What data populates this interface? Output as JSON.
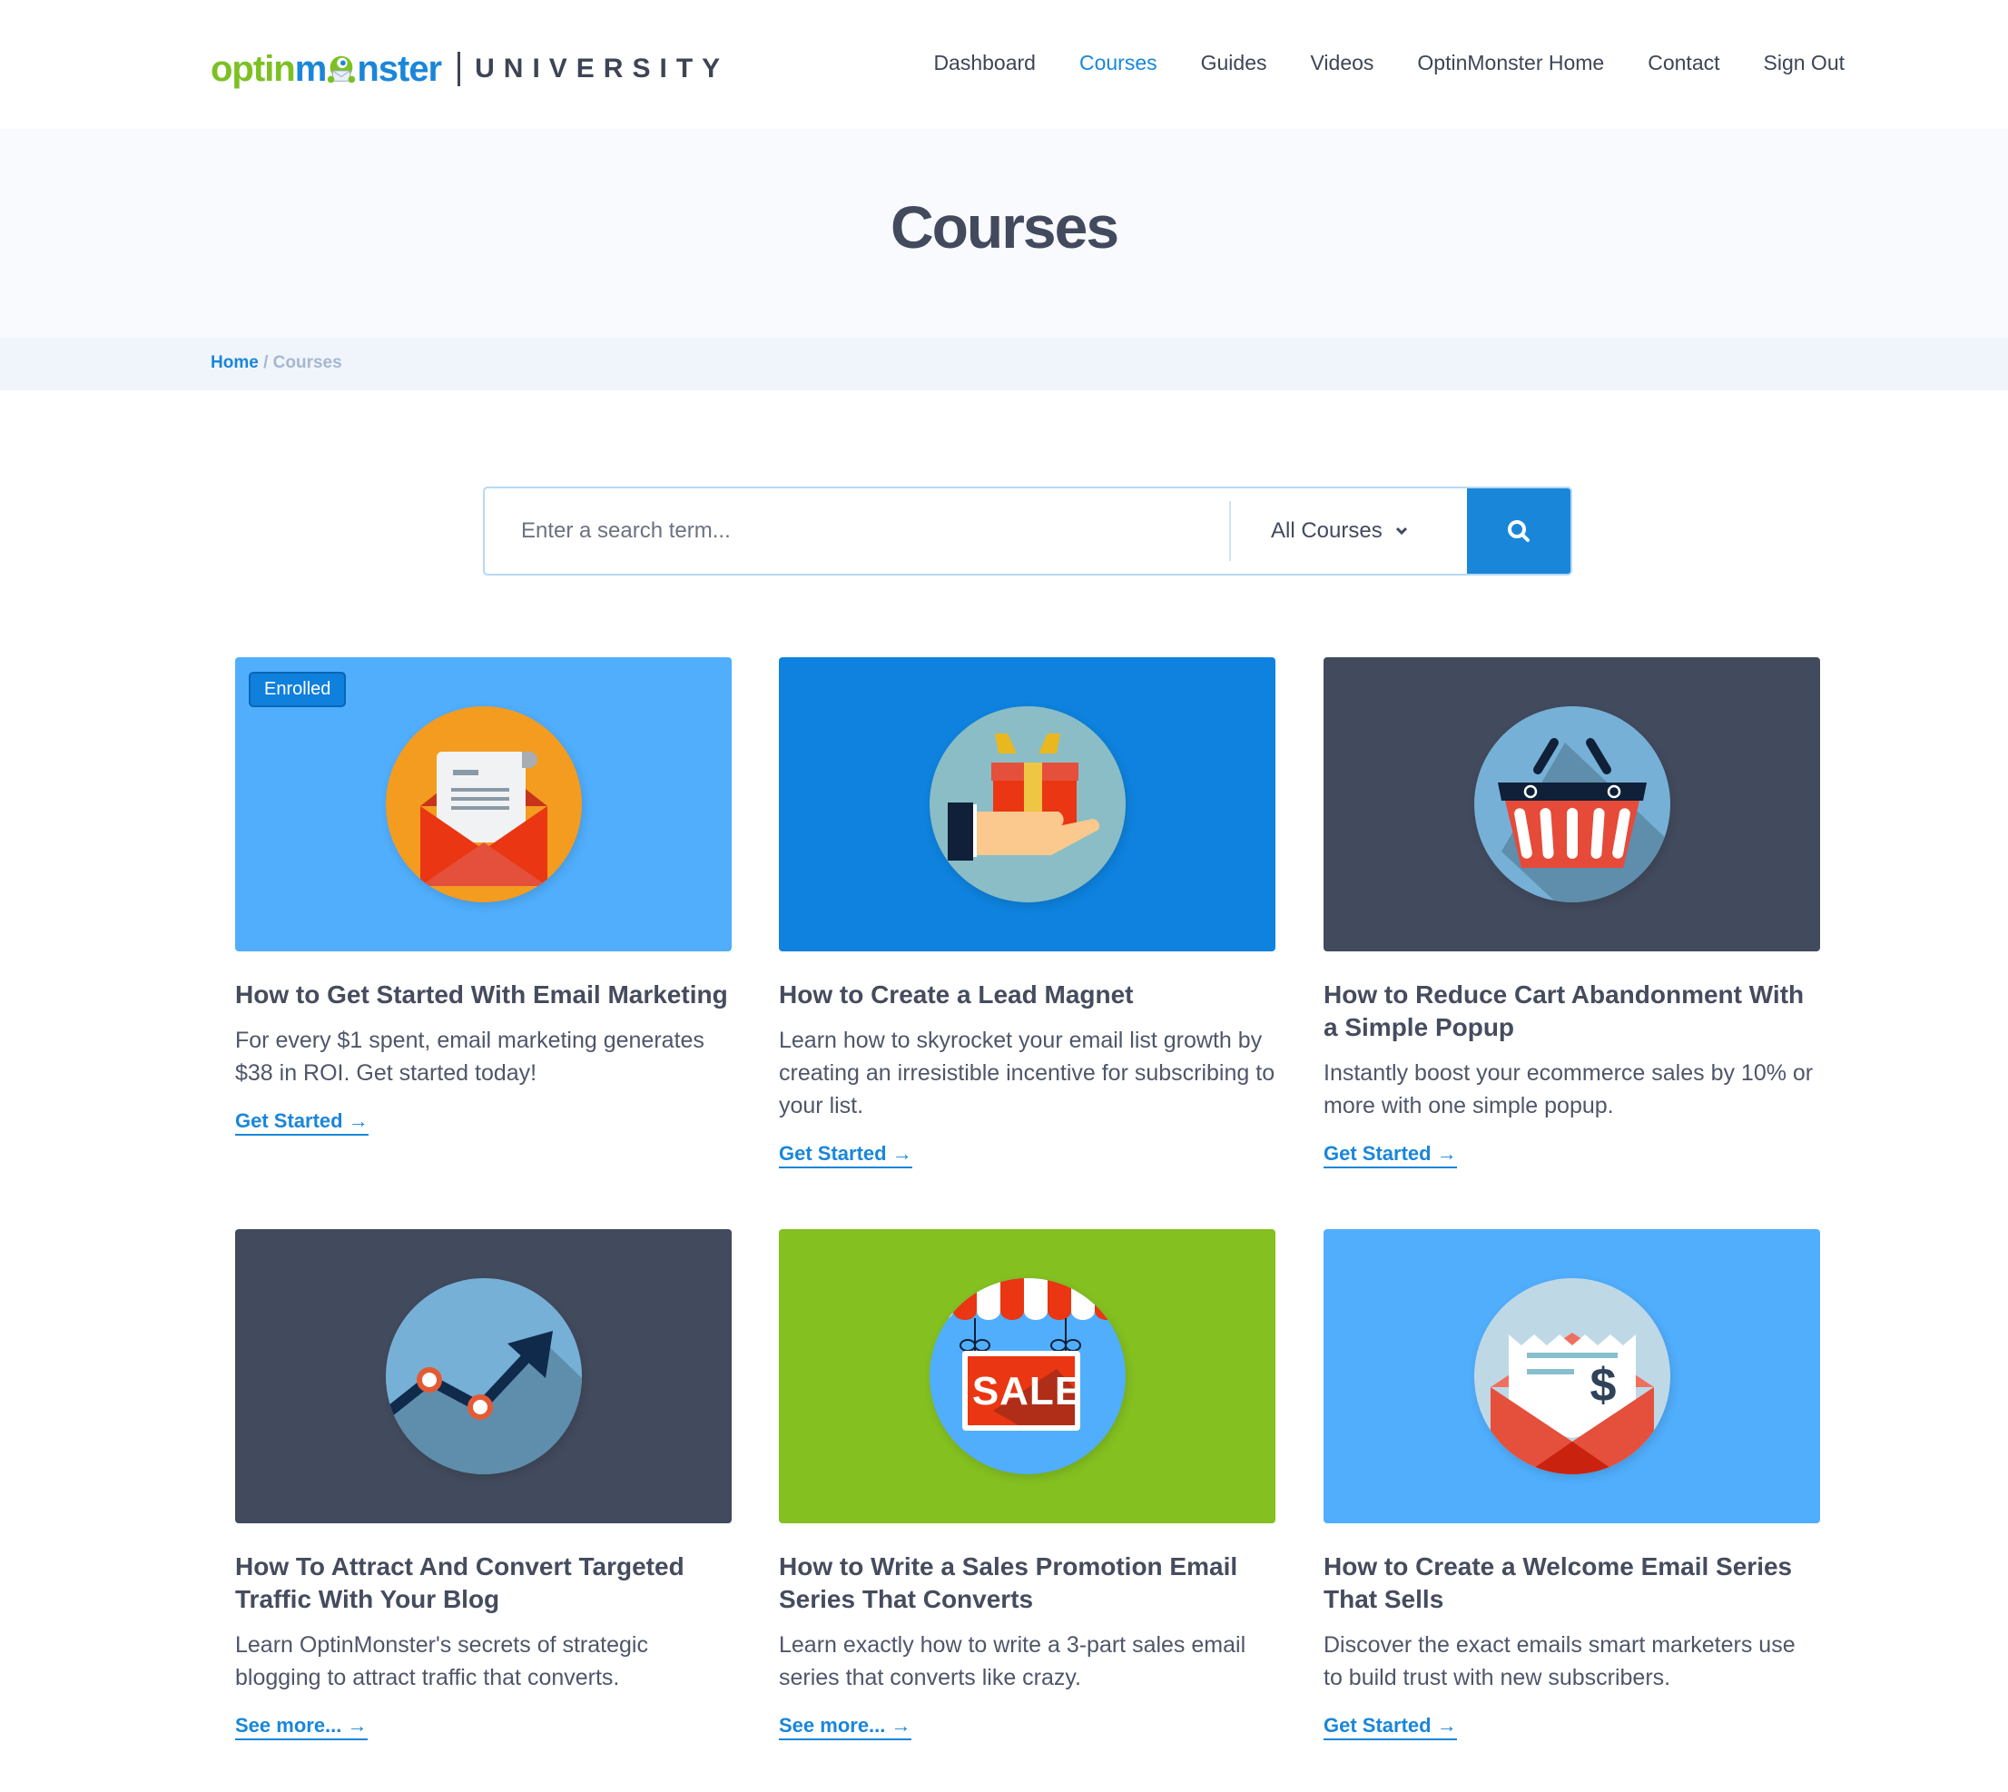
{
  "header": {
    "logo": {
      "optin": "optin",
      "monster_pre": "m",
      "monster_post": "nster",
      "university": "UNIVERSITY"
    },
    "nav": [
      {
        "label": "Dashboard",
        "active": false
      },
      {
        "label": "Courses",
        "active": true
      },
      {
        "label": "Guides",
        "active": false
      },
      {
        "label": "Videos",
        "active": false
      },
      {
        "label": "OptinMonster Home",
        "active": false
      },
      {
        "label": "Contact",
        "active": false
      },
      {
        "label": "Sign Out",
        "active": false
      }
    ]
  },
  "hero": {
    "title": "Courses"
  },
  "breadcrumb": {
    "home": "Home",
    "separator": " / ",
    "current": "Courses"
  },
  "search": {
    "placeholder": "Enter a search term...",
    "value": "",
    "filter_selected": "All Courses",
    "submit_icon": "search-icon"
  },
  "colors": {
    "accent": "#1a86d9",
    "logo_green": "#7cc022",
    "text_dark": "#454c5e",
    "hero_bg": "#f8fafd",
    "breadcrumb_bg": "#f0f5fc"
  },
  "courses": [
    {
      "title": "How to Get Started With Email Marketing",
      "description": "For every $1 spent, email marketing generates $38 in ROI. Get started today!",
      "link": "Get Started →",
      "badge": "Enrolled",
      "image_icon": "open-envelope-letter-icon",
      "image_bg": "#50aefc",
      "circle_bg": "#f39c20"
    },
    {
      "title": "How to Create a Lead Magnet",
      "description": "Learn how to skyrocket your email list growth by creating an irresistible incentive for subscribing to your list.",
      "link": "Get Started →",
      "badge": null,
      "image_icon": "hand-gift-icon",
      "image_bg": "#0e82de",
      "circle_bg": "#8bbdc6"
    },
    {
      "title": "How to Reduce Cart Abandonment With a Simple Popup",
      "description": "Instantly boost your ecommerce sales by 10% or more with one simple popup.",
      "link": "Get Started →",
      "badge": null,
      "image_icon": "shopping-basket-icon",
      "image_bg": "#424a5d",
      "circle_bg": "#76b0d6"
    },
    {
      "title": "How To Attract And Convert Targeted Traffic With Your Blog",
      "description": "Learn OptinMonster's secrets of strategic blogging to attract traffic that converts.",
      "link": "See more... →",
      "badge": null,
      "image_icon": "trend-arrow-chart-icon",
      "image_bg": "#424a5d",
      "circle_bg": "#76b0d6"
    },
    {
      "title": "How to Write a Sales Promotion Email Series That Converts",
      "description": "Learn exactly how to write a 3-part sales email series that converts like crazy.",
      "link": "See more... →",
      "badge": null,
      "image_icon": "sale-sign-icon",
      "image_bg": "#84c020",
      "circle_bg": "#50aefc",
      "sign_text": "SALE"
    },
    {
      "title": "How to Create a Welcome Email Series That Sells",
      "description": "Discover the exact emails smart marketers use to build trust with new subscribers.",
      "link": "Get Started →",
      "badge": null,
      "image_icon": "envelope-receipt-dollar-icon",
      "image_bg": "#50aefc",
      "circle_bg": "#bfd8e6",
      "receipt_symbol": "$"
    }
  ]
}
